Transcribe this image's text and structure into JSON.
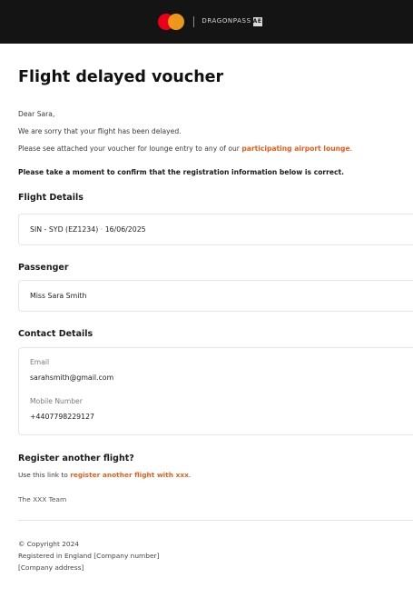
{
  "header": {
    "brand_name": "DRAGONPASS",
    "brand_badge": "AE",
    "mastercard_colors": [
      "#eb001b",
      "#f79e1b"
    ],
    "background": "#141414"
  },
  "title": "Flight delayed voucher",
  "greeting": "Dear Sara,",
  "intro_line": "We are sorry that your flight has been delayed.",
  "voucher_line_prefix": "Please see attached your voucher for lounge entry to any of our ",
  "voucher_link": "participating airport lounge",
  "voucher_line_suffix": ".",
  "confirm_text": "Please take a moment to confirm that the registration information below is correct.",
  "flight": {
    "section_title": "Flight Details",
    "route": "SIN - SYD (EZ1234)",
    "separator": "·",
    "date": "16/06/2025"
  },
  "passenger": {
    "section_title": "Passenger",
    "name": "Miss Sara Smith"
  },
  "contact": {
    "section_title": "Contact Details",
    "email_label": "Email",
    "email": "sarahsmith@gmail.com",
    "mobile_label": "Mobile Number",
    "mobile": "+4407798229127"
  },
  "register": {
    "title": "Register another flight?",
    "text_prefix": "Use this link to ",
    "link": "register another flight with xxx",
    "text_suffix": "."
  },
  "signoff": "The XXX Team",
  "footer": {
    "copyright": "© Copyright 2024",
    "registered": "Registered in England [Company number]",
    "address": "[Company address]"
  },
  "accent_color": "#e85d1c"
}
